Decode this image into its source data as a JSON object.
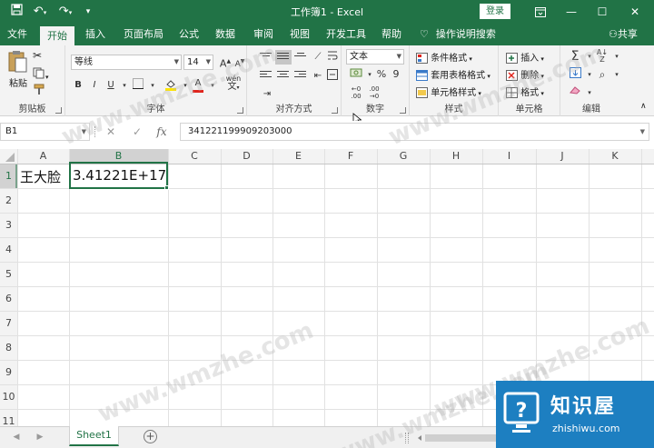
{
  "window": {
    "title": "工作簿1 - Excel",
    "login_label": "登录"
  },
  "quick_access": {
    "save_icon": "save-icon",
    "undo_icon": "undo-icon",
    "redo_icon": "redo-icon",
    "customize_icon": "chevron-down-icon"
  },
  "ribbon_tabs": [
    {
      "label": "文件",
      "active": false
    },
    {
      "label": "开始",
      "active": true
    },
    {
      "label": "插入",
      "active": false
    },
    {
      "label": "页面布局",
      "active": false
    },
    {
      "label": "公式",
      "active": false
    },
    {
      "label": "数据",
      "active": false
    },
    {
      "label": "审阅",
      "active": false
    },
    {
      "label": "视图",
      "active": false
    },
    {
      "label": "开发工具",
      "active": false
    },
    {
      "label": "帮助",
      "active": false
    }
  ],
  "tell_me": "操作说明搜索",
  "share": "共享",
  "ribbon": {
    "clipboard": {
      "label": "剪贴板",
      "paste": "粘贴"
    },
    "font": {
      "label": "字体",
      "font_name": "等线",
      "font_size": "14",
      "bold": "B",
      "italic": "I",
      "underline": "U",
      "font_color_letter": "A",
      "phonetic": "wén",
      "grow": "A",
      "shrink": "A"
    },
    "alignment": {
      "label": "对齐方式"
    },
    "number": {
      "label": "数字",
      "format": "文本",
      "percent": "%",
      "comma": "9"
    },
    "styles": {
      "label": "样式",
      "conditional": "条件格式",
      "table": "套用表格格式",
      "cell_styles": "单元格样式"
    },
    "cells": {
      "label": "单元格",
      "insert": "插入",
      "delete": "删除",
      "format": "格式"
    },
    "editing": {
      "label": "编辑"
    }
  },
  "formula_bar": {
    "name_box": "B1",
    "cancel": "✕",
    "enter": "✓",
    "fx": "fx",
    "value": "341221199909203000"
  },
  "grid": {
    "columns": [
      "A",
      "B",
      "C",
      "D",
      "E",
      "F",
      "G",
      "H",
      "I",
      "J",
      "K"
    ],
    "rows": [
      "1",
      "2",
      "3",
      "4",
      "5",
      "6",
      "7",
      "8",
      "9",
      "10",
      "11"
    ],
    "selected_cell": "B1",
    "cells": {
      "A1": "王大脸",
      "B1": "3.41221E+17"
    }
  },
  "sheets": {
    "tabs": [
      "Sheet1"
    ],
    "active": "Sheet1"
  },
  "watermark": {
    "text": "www.wmzhe.com",
    "logo_title": "知识屋",
    "logo_sub": "zhishiwu.com"
  },
  "colors": {
    "excel_green": "#217346",
    "ribbon_bg": "#f3f3f3",
    "grid_line": "#e1e1e1",
    "selection": "#217346",
    "logo_blue": "#1d7fc1"
  }
}
